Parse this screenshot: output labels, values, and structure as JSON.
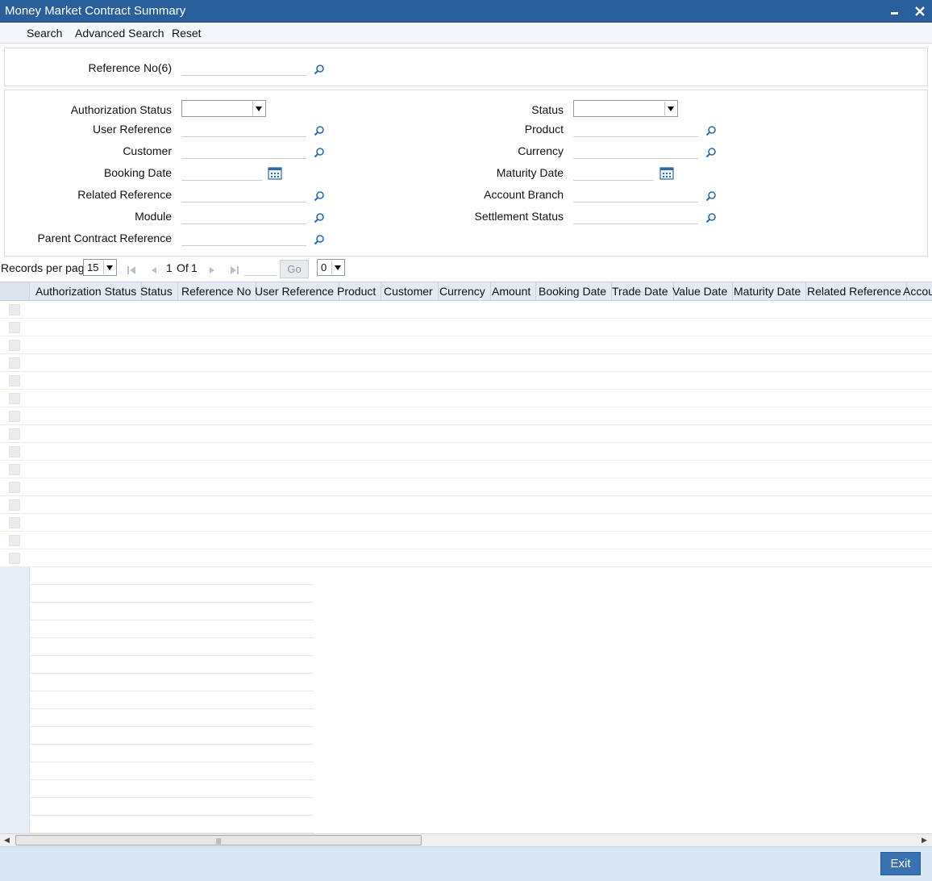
{
  "window": {
    "title": "Money Market Contract Summary"
  },
  "menu": {
    "search": "Search",
    "advanced_search": "Advanced Search",
    "reset": "Reset"
  },
  "top_panel": {
    "reference_no_label": "Reference No(6)",
    "reference_no_value": ""
  },
  "criteria": {
    "authorization_status": {
      "label": "Authorization Status",
      "value": ""
    },
    "user_reference": {
      "label": "User Reference",
      "value": ""
    },
    "customer": {
      "label": "Customer",
      "value": ""
    },
    "booking_date": {
      "label": "Booking Date",
      "value": ""
    },
    "related_reference": {
      "label": "Related Reference",
      "value": ""
    },
    "module": {
      "label": "Module",
      "value": ""
    },
    "parent_contract_reference": {
      "label": "Parent Contract Reference",
      "value": ""
    },
    "status": {
      "label": "Status",
      "value": ""
    },
    "product": {
      "label": "Product",
      "value": ""
    },
    "currency": {
      "label": "Currency",
      "value": ""
    },
    "maturity_date": {
      "label": "Maturity Date",
      "value": ""
    },
    "account_branch": {
      "label": "Account Branch",
      "value": ""
    },
    "settlement_status": {
      "label": "Settlement Status",
      "value": ""
    }
  },
  "pager": {
    "records_per_page_label": "Records per page",
    "records_per_page_value": "15",
    "current_page": "1",
    "of_label": "Of",
    "total_pages": "1",
    "go_label": "Go",
    "page_select_value": "0"
  },
  "grid": {
    "columns": [
      "Authorization Status",
      "Status",
      "Reference No",
      "User Reference",
      "Product",
      "Customer",
      "Currency",
      "Amount",
      "Booking Date",
      "Trade Date",
      "Value Date",
      "Maturity Date",
      "Related Reference",
      "Accou"
    ],
    "data_rows": 15,
    "empty_rows": 15
  },
  "footer": {
    "exit_label": "Exit"
  },
  "colors": {
    "title_bar": "#2b5f9c",
    "footer": "#d9e7f4",
    "exit_button": "#3a71b0"
  }
}
